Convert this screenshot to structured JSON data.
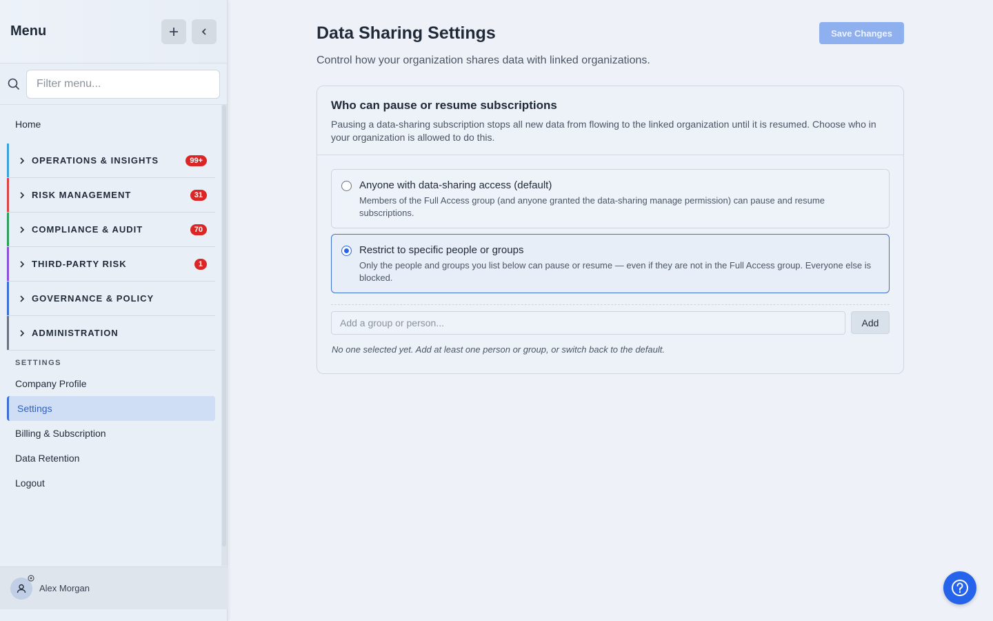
{
  "sidebar": {
    "title": "Menu",
    "filter_placeholder": "Filter menu...",
    "home": "Home",
    "sections": [
      {
        "label": "OPERATIONS & INSIGHTS",
        "badge": "99+",
        "color": "#3b9fd9"
      },
      {
        "label": "RISK MANAGEMENT",
        "badge": "31",
        "color": "#d94343"
      },
      {
        "label": "COMPLIANCE & AUDIT",
        "badge": "70",
        "color": "#2e9e5e"
      },
      {
        "label": "THIRD-PARTY RISK",
        "badge": "1",
        "color": "#8a4fd6"
      },
      {
        "label": "GOVERNANCE & POLICY",
        "badge": "",
        "color": "#3b6fd4"
      },
      {
        "label": "ADMINISTRATION",
        "badge": "",
        "color": "#6b7280"
      }
    ],
    "settings_heading": "SETTINGS",
    "settings_items": [
      "Company Profile",
      "Settings",
      "Billing & Subscription",
      "Data Retention",
      "Logout"
    ],
    "active_item": "Settings",
    "user_name": "Alex Morgan"
  },
  "main": {
    "title": "Data Sharing Settings",
    "subtitle": "Control how your organization shares data with linked organizations.",
    "save_label": "Save Changes",
    "card": {
      "title": "Who can pause or resume subscriptions",
      "description": "Pausing a data-sharing subscription stops all new data from flowing to the linked organization until it is resumed. Choose who in your organization is allowed to do this.",
      "options": [
        {
          "title": "Anyone with data-sharing access (default)",
          "description": "Members of the Full Access group (and anyone granted the data-sharing manage permission) can pause and resume subscriptions.",
          "selected": false
        },
        {
          "title": "Restrict to specific people or groups",
          "description": "Only the people and groups you list below can pause or resume — even if they are not in the Full Access group. Everyone else is blocked.",
          "selected": true
        }
      ],
      "add_placeholder": "Add a group or person...",
      "add_label": "Add",
      "empty_note": "No one selected yet. Add at least one person or group, or switch back to the default."
    }
  },
  "colors": {
    "accent": "#2563eb",
    "badge": "#dc2626",
    "save_disabled": "#8fb0ef"
  },
  "icons": [
    "plus-icon",
    "chevron-left-icon",
    "search-icon",
    "chevron-right-icon",
    "user-icon",
    "gear-icon",
    "help-icon"
  ]
}
